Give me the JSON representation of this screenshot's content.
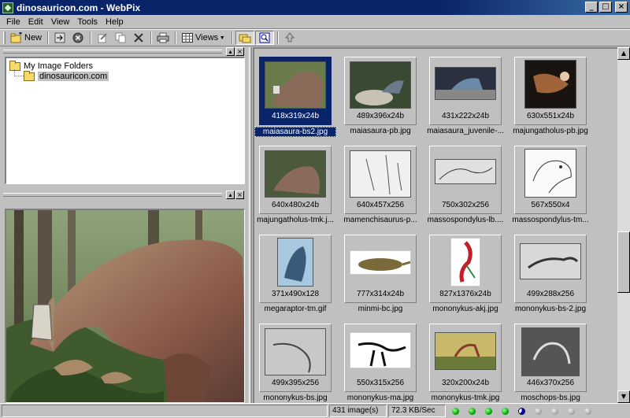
{
  "window": {
    "title": "dinosauricon.com - WebPix"
  },
  "menu": [
    {
      "label": "File",
      "key": "F"
    },
    {
      "label": "Edit",
      "key": "E"
    },
    {
      "label": "View",
      "key": "V"
    },
    {
      "label": "Tools",
      "key": "T"
    },
    {
      "label": "Help",
      "key": "H"
    }
  ],
  "toolbar": {
    "new_label": "New",
    "views_label": "Views"
  },
  "tree": {
    "root": "My Image Folders",
    "child": "dinosauricon.com"
  },
  "thumbnails": [
    {
      "dims": "418x319x24b",
      "name": "maiasaura-bs2.jpg",
      "selected": true
    },
    {
      "dims": "489x396x24b",
      "name": "maiasaura-pb.jpg"
    },
    {
      "dims": "431x222x24b",
      "name": "maiasaura_juvenile-..."
    },
    {
      "dims": "630x551x24b",
      "name": "majungatholus-pb.jpg"
    },
    {
      "dims": "640x480x24b",
      "name": "majungatholus-tmk.j..."
    },
    {
      "dims": "640x457x256",
      "name": "mamenchisaurus-p..."
    },
    {
      "dims": "750x302x256",
      "name": "massospondylus-lb...."
    },
    {
      "dims": "567x550x4",
      "name": "massospondylus-tm..."
    },
    {
      "dims": "371x490x128",
      "name": "megaraptor-tm.gif"
    },
    {
      "dims": "777x314x24b",
      "name": "minmi-bc.jpg"
    },
    {
      "dims": "827x1376x24b",
      "name": "mononykus-akj.jpg"
    },
    {
      "dims": "499x288x256",
      "name": "mononykus-bs-2.jpg"
    },
    {
      "dims": "499x395x256",
      "name": "mononykus-bs.jpg"
    },
    {
      "dims": "550x315x256",
      "name": "mononykus-ma.jpg"
    },
    {
      "dims": "320x200x24b",
      "name": "mononykus-tmk.jpg"
    },
    {
      "dims": "446x370x256",
      "name": "moschops-bs.jpg"
    }
  ],
  "status": {
    "count": "431 image(s)",
    "speed": "72.3 KB/Sec"
  },
  "colors": {
    "title_bar": "#0a246a",
    "face": "#c0c0c0",
    "selection": "#0a246a"
  }
}
